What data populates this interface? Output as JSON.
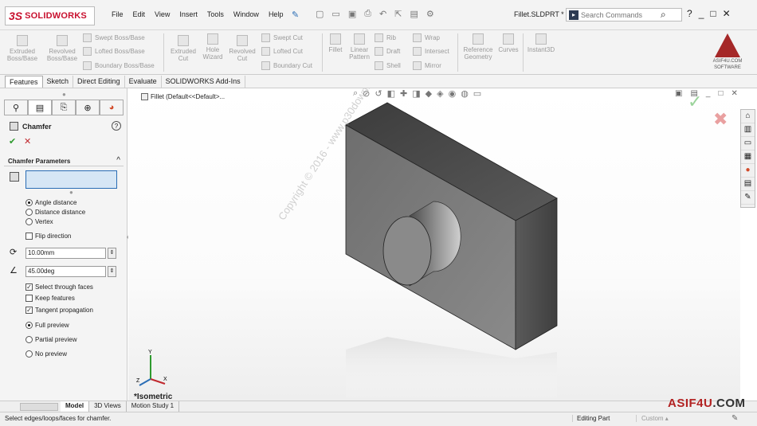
{
  "app": {
    "brand_ds": "3S",
    "brand_name": "SOLIDWORKS",
    "document_title": "Fillet.SLDPRT *"
  },
  "menu": [
    "File",
    "Edit",
    "View",
    "Insert",
    "Tools",
    "Window",
    "Help"
  ],
  "search": {
    "placeholder": "Search Commands",
    "icon": "magnifier-icon"
  },
  "title_controls": {
    "help": "?",
    "minimize": "_",
    "restore": "□",
    "close": "✕"
  },
  "command_manager": {
    "extruded_boss": "Extruded Boss/Base",
    "revolved_boss": "Revolved Boss/Base",
    "swept_boss": "Swept Boss/Base",
    "lofted_boss": "Lofted Boss/Base",
    "boundary_boss": "Boundary Boss/Base",
    "extruded_cut": "Extruded Cut",
    "hole_wizard": "Hole Wizard",
    "revolved_cut": "Revolved Cut",
    "swept_cut": "Swept Cut",
    "lofted_cut": "Lofted Cut",
    "boundary_cut": "Boundary Cut",
    "fillet": "Fillet",
    "linear_pattern": "Linear Pattern",
    "rib": "Rib",
    "draft": "Draft",
    "shell": "Shell",
    "wrap": "Wrap",
    "intersect": "Intersect",
    "mirror": "Mirror",
    "reference_geometry": "Reference Geometry",
    "curves": "Curves",
    "instant3d": "Instant3D"
  },
  "brand_logo": {
    "site": "ASIF4U.COM",
    "tag": "SOFTWARE"
  },
  "tabs": [
    {
      "label": "Features",
      "active": true
    },
    {
      "label": "Sketch",
      "active": false
    },
    {
      "label": "Direct Editing",
      "active": false
    },
    {
      "label": "Evaluate",
      "active": false
    },
    {
      "label": "SOLIDWORKS Add-Ins",
      "active": false
    }
  ],
  "property_manager": {
    "title": "Chamfer",
    "help": "?",
    "ok": "✔",
    "cancel": "✕",
    "section_title": "Chamfer Parameters",
    "collapse": "^",
    "options": {
      "angle_distance": "Angle distance",
      "distance_distance": "Distance distance",
      "vertex": "Vertex",
      "flip_direction": "Flip direction",
      "select_through_faces": "Select through faces",
      "keep_features": "Keep features",
      "tangent_propagation": "Tangent propagation",
      "full_preview": "Full preview",
      "partial_preview": "Partial preview",
      "no_preview": "No preview"
    },
    "distance_value": "10.00mm",
    "angle_value": "45.00deg",
    "spinner": "⇕"
  },
  "viewport": {
    "breadcrumb": "Fillet  (Default<<Default>...",
    "view_label": "*Isometric",
    "watermark": "Copyright © 2016 - www.p30download.com",
    "triad_x": "X",
    "triad_y": "Y",
    "triad_z": "Z"
  },
  "bottom_tabs": [
    {
      "label": "Model",
      "active": true
    },
    {
      "label": "3D Views",
      "active": false
    },
    {
      "label": "Motion Study 1",
      "active": false
    }
  ],
  "status": {
    "message": "Select edges/loops/faces for chamfer.",
    "mode": "Editing Part",
    "units": "Custom",
    "units_arrow": "▴"
  },
  "site_watermark": {
    "name": "ASIF4U",
    "tld": ".COM"
  },
  "colors": {
    "accent": "#2a6db5",
    "brand_red": "#c8102e",
    "ok_green": "#2e9a2e",
    "cancel_red": "#c0282e",
    "selection_blue": "#d6e6f5"
  }
}
